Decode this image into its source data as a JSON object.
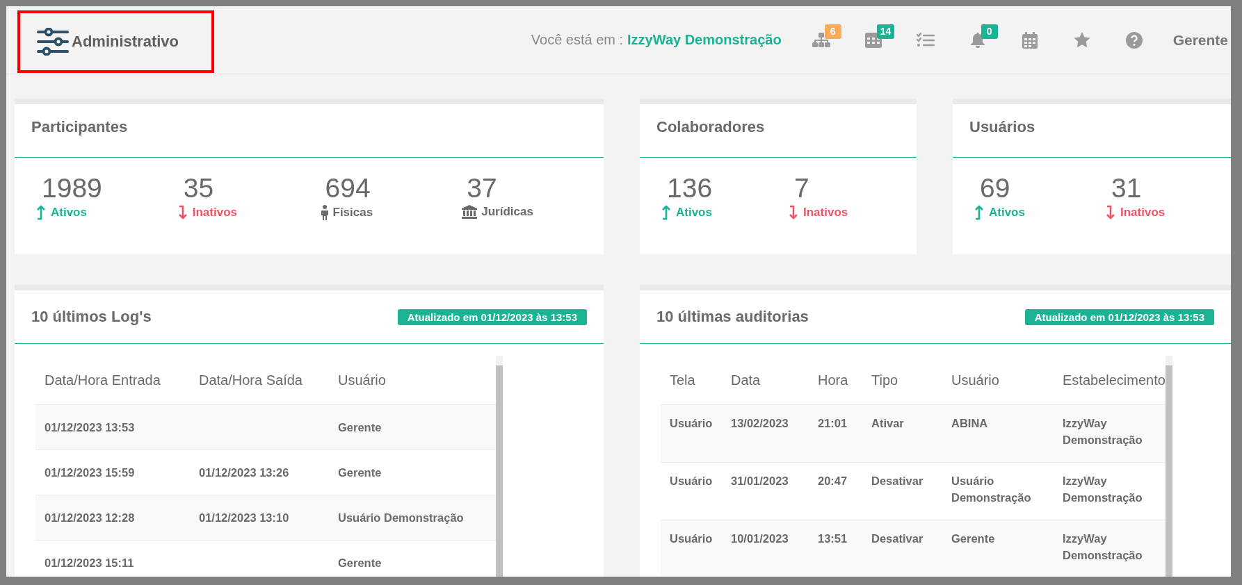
{
  "header": {
    "module": "Administrativo",
    "location_label": "Você está em :",
    "location": "IzzyWay Demonstração",
    "toolbar": [
      {
        "kind": "sitemap",
        "badge": "6",
        "color": "#f8ac59"
      },
      {
        "kind": "grid-calendar",
        "badge": "14",
        "color": "#1ab394"
      },
      {
        "kind": "checklist"
      },
      {
        "kind": "bell",
        "badge": "0",
        "color": "#1ab394"
      },
      {
        "kind": "calendar"
      },
      {
        "kind": "star"
      },
      {
        "kind": "help"
      }
    ],
    "user": "Gerente"
  },
  "summary_cards": [
    {
      "title": "Participantes",
      "stats": [
        {
          "value": "1989",
          "label": "Ativos",
          "kind": "up"
        },
        {
          "value": "35",
          "label": "Inativos",
          "kind": "down"
        },
        {
          "value": "694",
          "label": "Físicas",
          "kind": "person"
        },
        {
          "value": "37",
          "label": "Jurídicas",
          "kind": "institution"
        }
      ]
    },
    {
      "title": "Colaboradores",
      "stats": [
        {
          "value": "136",
          "label": "Ativos",
          "kind": "up"
        },
        {
          "value": "7",
          "label": "Inativos",
          "kind": "down"
        }
      ]
    },
    {
      "title": "Usuários",
      "stats": [
        {
          "value": "69",
          "label": "Ativos",
          "kind": "up"
        },
        {
          "value": "31",
          "label": "Inativos",
          "kind": "down"
        }
      ]
    }
  ],
  "table_cards": [
    {
      "title": "10 últimos Log's",
      "badge": "Atualizado em 01/12/2023 às 13:53",
      "columns": [
        "Data/Hora Entrada",
        "Data/Hora Saída",
        "Usuário"
      ],
      "rows": [
        [
          "01/12/2023 13:53",
          "",
          "Gerente"
        ],
        [
          "01/12/2023 15:59",
          "01/12/2023 13:26",
          "Gerente"
        ],
        [
          "01/12/2023 12:28",
          "01/12/2023 13:10",
          "Usuário Demonstração"
        ],
        [
          "01/12/2023 15:11",
          "",
          "Gerente"
        ]
      ]
    },
    {
      "title": "10 últimas auditorias",
      "badge": "Atualizado em 01/12/2023 às 13:53",
      "columns": [
        "Tela",
        "Data",
        "Hora",
        "Tipo",
        "Usuário",
        "Estabelecimento"
      ],
      "rows": [
        [
          "Usuário",
          "13/02/2023",
          "21:01",
          "Ativar",
          "ABINA",
          "IzzyWay Demonstração"
        ],
        [
          "Usuário",
          "31/01/2023",
          "20:47",
          "Desativar",
          "Usuário Demonstração",
          "IzzyWay Demonstração"
        ],
        [
          "Usuário",
          "10/01/2023",
          "13:51",
          "Desativar",
          "Gerente",
          "IzzyWay Demonstração"
        ]
      ]
    }
  ]
}
